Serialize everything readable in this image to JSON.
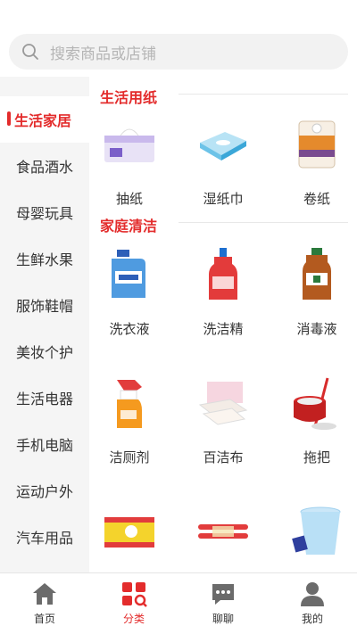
{
  "search": {
    "placeholder": "搜索商品或店铺"
  },
  "sidebar": {
    "items": [
      {
        "label": "生活家居",
        "active": true
      },
      {
        "label": "食品酒水"
      },
      {
        "label": "母婴玩具"
      },
      {
        "label": "生鲜水果"
      },
      {
        "label": "服饰鞋帽"
      },
      {
        "label": "美妆个护"
      },
      {
        "label": "生活电器"
      },
      {
        "label": "手机电脑"
      },
      {
        "label": "运动户外"
      },
      {
        "label": "汽车用品"
      }
    ]
  },
  "sections": [
    {
      "title": "生活用纸",
      "products": [
        {
          "label": "抽纸",
          "icon": "tissue-box-icon"
        },
        {
          "label": "湿纸巾",
          "icon": "wet-wipes-icon"
        },
        {
          "label": "卷纸",
          "icon": "toilet-roll-icon"
        }
      ]
    },
    {
      "title": "家庭清洁",
      "products": [
        {
          "label": "洗衣液",
          "icon": "laundry-detergent-icon"
        },
        {
          "label": "洗洁精",
          "icon": "dish-soap-icon"
        },
        {
          "label": "消毒液",
          "icon": "disinfectant-icon"
        },
        {
          "label": "洁厕剂",
          "icon": "toilet-cleaner-icon"
        },
        {
          "label": "百洁布",
          "icon": "scouring-cloth-icon"
        },
        {
          "label": "拖把",
          "icon": "mop-icon"
        },
        {
          "label": "",
          "icon": "trash-bag-icon"
        },
        {
          "label": "",
          "icon": "garbage-bag-roll-icon"
        },
        {
          "label": "",
          "icon": "bucket-icon"
        }
      ]
    }
  ],
  "nav": {
    "items": [
      {
        "label": "首页",
        "icon": "home-icon"
      },
      {
        "label": "分类",
        "icon": "category-icon",
        "active": true
      },
      {
        "label": "聊聊",
        "icon": "chat-icon"
      },
      {
        "label": "我的",
        "icon": "user-icon"
      }
    ]
  },
  "colors": {
    "accent": "#e32c2c",
    "sidebar_bg": "#f5f5f5"
  }
}
